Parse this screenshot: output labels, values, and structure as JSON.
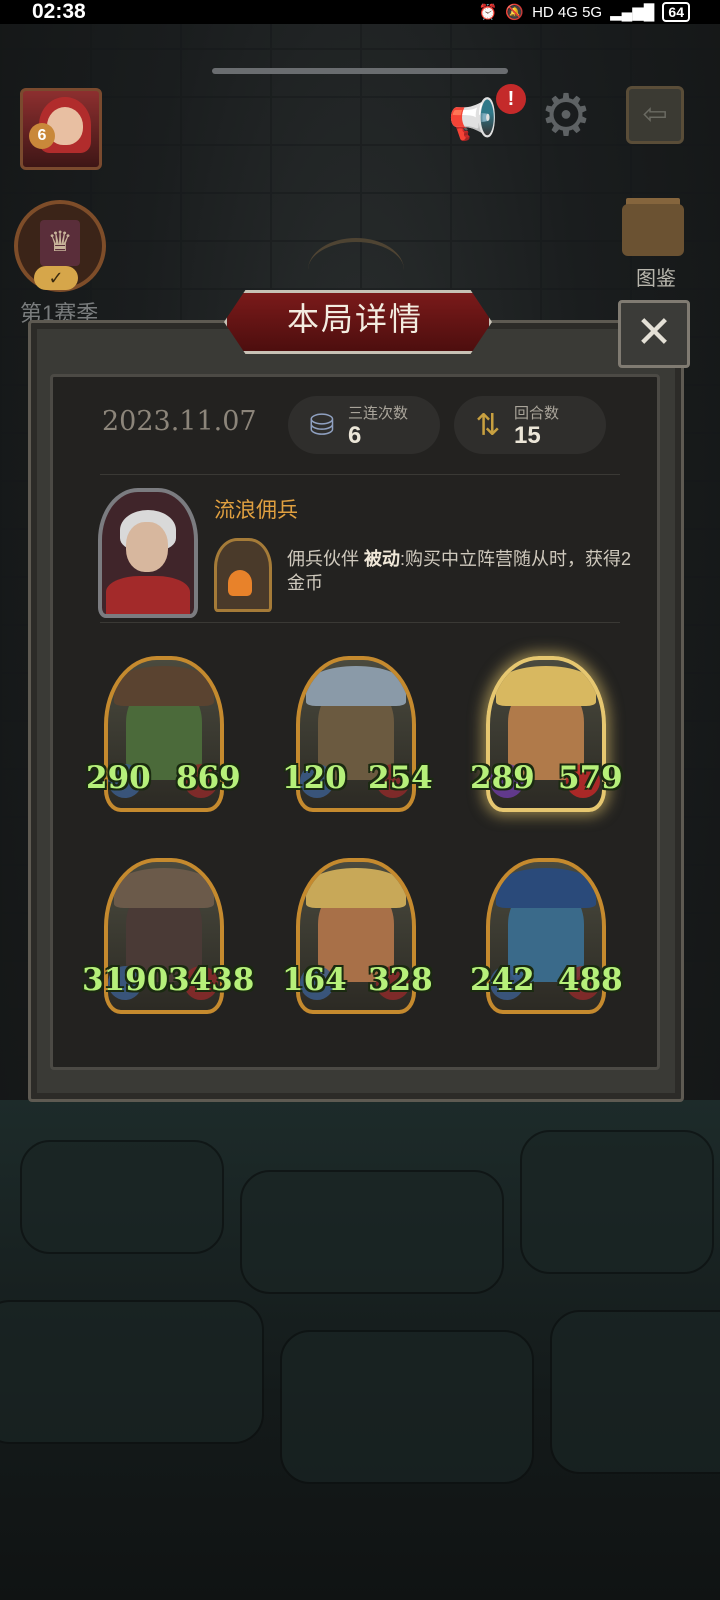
{
  "status_bar": {
    "time": "02:38",
    "network": "HD 4G 5G",
    "battery": "64"
  },
  "season": {
    "label": "第1赛季"
  },
  "codex": {
    "label": "图鉴"
  },
  "player": {
    "level": "6"
  },
  "notification": {
    "badge": "!"
  },
  "dialog": {
    "title": "本局详情",
    "close": "✕",
    "date": "2023.11.07",
    "triples": {
      "label": "三连次数",
      "value": "6"
    },
    "rounds": {
      "label": "回合数",
      "value": "15"
    },
    "hero": {
      "name": "流浪佣兵",
      "power_title": "佣兵伙伴",
      "power_type": "被动",
      "power_desc": ":购买中立阵营随从时，获得2金币"
    },
    "minions": [
      {
        "attack": "290",
        "health": "869",
        "golden": false,
        "theme": "goblin"
      },
      {
        "attack": "120",
        "health": "254",
        "golden": false,
        "theme": "mushroom"
      },
      {
        "attack": "289",
        "health": "579",
        "golden": true,
        "theme": "scarecrow"
      },
      {
        "attack": "3190",
        "health": "3438",
        "golden": false,
        "theme": "golem"
      },
      {
        "attack": "164",
        "health": "328",
        "golden": false,
        "theme": "scarecrow"
      },
      {
        "attack": "242",
        "health": "488",
        "golden": false,
        "theme": "elf"
      }
    ]
  }
}
